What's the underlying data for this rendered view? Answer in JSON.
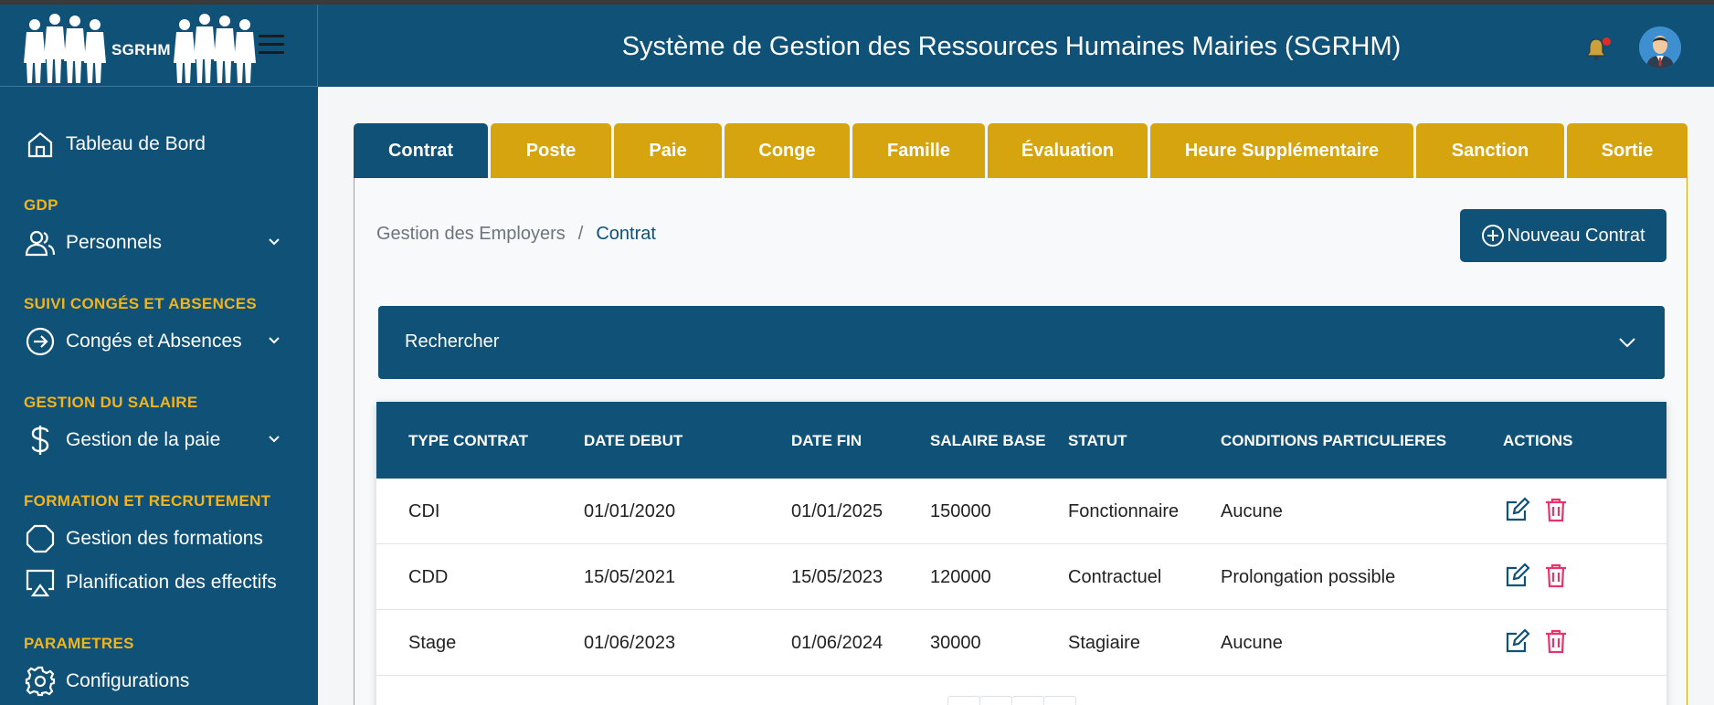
{
  "logo": {
    "text": "SGRHM"
  },
  "header": {
    "title": "Système de Gestion des Ressources Humaines Mairies (SGRHM)"
  },
  "sidebar": {
    "dashboard": "Tableau de Bord",
    "sections": {
      "gdp": "GDP",
      "conges": "SUIVI CONGÉS ET ABSENCES",
      "salaire": "GESTION DU SALAIRE",
      "formation": "FORMATION ET RECRUTEMENT",
      "parametres": "PARAMETRES"
    },
    "items": {
      "personnels": "Personnels",
      "conges": "Congés et Absences",
      "paie": "Gestion de la paie",
      "formations": "Gestion des formations",
      "effectifs": "Planification des effectifs",
      "configurations": "Configurations"
    }
  },
  "tabs": [
    "Contrat",
    "Poste",
    "Paie",
    "Conge",
    "Famille",
    "Évaluation",
    "Heure Supplémentaire",
    "Sanction",
    "Sortie"
  ],
  "breadcrumb": {
    "parent": "Gestion des Employers",
    "separator": "/",
    "current": "Contrat"
  },
  "new_button": {
    "label": "Nouveau Contrat"
  },
  "search": {
    "label": "Rechercher"
  },
  "table": {
    "headers": [
      "TYPE CONTRAT",
      "DATE DEBUT",
      "DATE FIN",
      "SALAIRE BASE",
      "STATUT",
      "CONDITIONS PARTICULIERES",
      "ACTIONS"
    ],
    "rows": [
      [
        "CDI",
        "01/01/2020",
        "01/01/2025",
        "150000",
        "Fonctionnaire",
        "Aucune"
      ],
      [
        "CDD",
        "15/05/2021",
        "15/05/2023",
        "120000",
        "Contractuel",
        "Prolongation possible"
      ],
      [
        "Stage",
        "01/06/2023",
        "01/06/2024",
        "30000",
        "Stagiaire",
        "Aucune"
      ]
    ]
  },
  "colors": {
    "primary": "#0f5177",
    "accent": "#d6a40f",
    "section": "#f2b41b",
    "danger": "#e8336b"
  },
  "icons": [
    "home-icon",
    "users-icon",
    "arrow-circle-icon",
    "dollar-icon",
    "octagon-icon",
    "screen-share-icon",
    "gear-icon",
    "bell-icon",
    "edit-icon",
    "trash-icon",
    "plus-circle-icon",
    "chevron-down-icon"
  ]
}
